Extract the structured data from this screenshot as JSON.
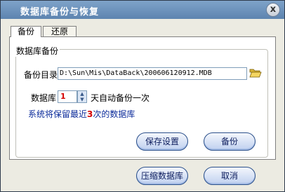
{
  "window": {
    "title": "数据库备份与恢复",
    "close_label": "x"
  },
  "tabs": [
    {
      "label": "备份"
    },
    {
      "label": "还原"
    }
  ],
  "group": {
    "title": "数据库备份"
  },
  "backup_dir": {
    "label": "备份目录",
    "value": "D:\\Sun\\Mis\\DataBack\\200606120912.MDB"
  },
  "schedule": {
    "prefix": "数据库",
    "days": "1",
    "suffix": "天自动备份一次"
  },
  "retention": {
    "prefix": "系统将保留最近",
    "count": "3",
    "suffix": "次的数据库"
  },
  "buttons": {
    "save_settings": "保存设置",
    "backup": "备份",
    "compress": "压缩数据库",
    "cancel": "取消"
  },
  "icons": {
    "folder": "folder-open-icon",
    "spin_up": "spin-up-arrow-icon",
    "spin_down": "spin-down-arrow-icon",
    "close": "close-icon"
  },
  "colors": {
    "title_bar": "#6b8fba",
    "note_text": "#0a2a9a",
    "highlight": "#d40000"
  }
}
